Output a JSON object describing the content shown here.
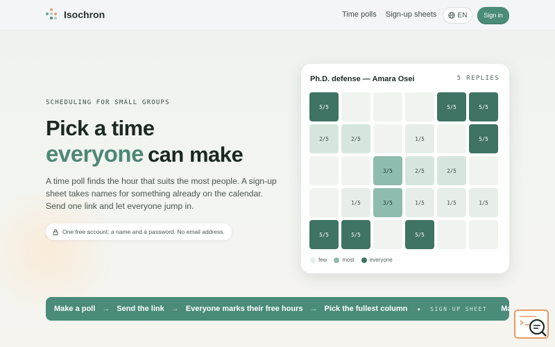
{
  "brand": {
    "name": "Isochron"
  },
  "nav": {
    "time_polls": "Time polls",
    "signup_sheets": "Sign-up sheets",
    "language": "EN",
    "sign_in": "Sign in"
  },
  "hero": {
    "eyebrow": "SCHEDULING FOR SMALL GROUPS",
    "headline_line1": "Pick a time",
    "headline_accent": "everyone",
    "headline_rest": "can make",
    "lede": "A time poll finds the hour that suits the most people. A sign-up sheet takes names for something already on the calendar. Send one link and let everyone jump in.",
    "note": "One free account: a name and a password. No email address."
  },
  "poll_card": {
    "title": "Ph.D. defense — Amara Osei",
    "replies": "5 REPLIES",
    "rows": [
      [
        "5/5",
        "",
        "",
        "",
        "5/5",
        "5/5"
      ],
      [
        "2/5",
        "2/5",
        "",
        "1/5",
        "",
        "5/5"
      ],
      [
        "",
        "",
        "3/5",
        "2/5",
        "2/5",
        ""
      ],
      [
        "",
        "1/5",
        "3/5",
        "1/5",
        "1/5",
        "1/5"
      ],
      [
        "5/5",
        "5/5",
        "",
        "5/5",
        "",
        ""
      ]
    ],
    "legend": {
      "few": "few",
      "most": "most",
      "everyone": "everyone"
    }
  },
  "ticker": {
    "steps": [
      "Make a poll",
      "Send the link",
      "Everyone marks their free hours",
      "Pick the fullest column"
    ],
    "tag": "SIGN-UP SHEET",
    "trailing": "Make a"
  },
  "colors": {
    "accent": "#4a8b7a",
    "accent_text": "#4e8777",
    "heat_empty": "#f1f3f1",
    "heat_few": "#e7eee9",
    "heat_low": "#d6e6de",
    "heat_mid": "#8ebcae",
    "heat_full": "#3f7363"
  }
}
